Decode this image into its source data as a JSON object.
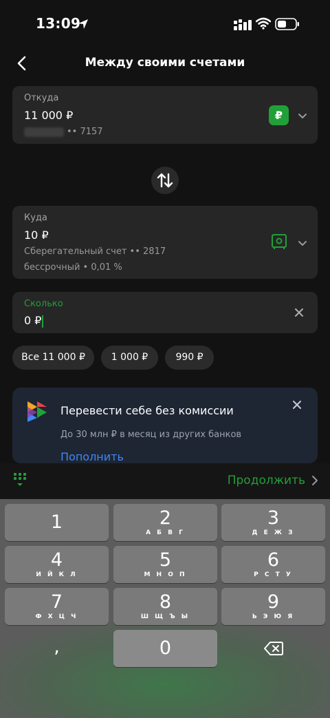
{
  "status": {
    "time": "13:09"
  },
  "header": {
    "title": "Между своими счетами"
  },
  "from_card": {
    "label": "Откуда",
    "amount": "11 000 ₽",
    "account_mask": "•• 7157",
    "currency_badge": "₽"
  },
  "to_card": {
    "label": "Куда",
    "amount": "10 ₽",
    "account_name": "Сберегательный счет •• 2817",
    "terms": "бессрочный • 0,01 %"
  },
  "amount_field": {
    "label": "Сколько",
    "value": "0 ₽"
  },
  "quick_amounts": [
    "Все 11 000 ₽",
    "1 000 ₽",
    "990 ₽"
  ],
  "promo": {
    "title": "Перевести себе без комиссии",
    "text": "До 30 млн ₽ в месяц из других банков",
    "link": "Пополнить"
  },
  "action": {
    "continue_label": "Продолжить"
  },
  "keyboard": {
    "keys": [
      {
        "digit": "1",
        "letters": ""
      },
      {
        "digit": "2",
        "letters": "А Б В Г"
      },
      {
        "digit": "3",
        "letters": "Д Е Ж З"
      },
      {
        "digit": "4",
        "letters": "И Й К Л"
      },
      {
        "digit": "5",
        "letters": "М Н О П"
      },
      {
        "digit": "6",
        "letters": "Р С Т У"
      },
      {
        "digit": "7",
        "letters": "Ф Х Ц Ч"
      },
      {
        "digit": "8",
        "letters": "Ш Щ Ъ Ы"
      },
      {
        "digit": "9",
        "letters": "Ь Э Ю Я"
      },
      {
        "digit": ",",
        "letters": ""
      },
      {
        "digit": "0",
        "letters": ""
      }
    ]
  },
  "colors": {
    "accent_green": "#21a038",
    "link_blue": "#3f88f5",
    "card_bg": "#262626",
    "promo_bg": "#1e2533"
  },
  "icons": [
    "location-arrow-icon",
    "signal-icon",
    "wifi-icon",
    "battery-icon",
    "back-arrow-icon",
    "chevron-down-icon",
    "ruble-badge-icon",
    "safe-icon",
    "swap-arrows-icon",
    "clear-icon",
    "sber-logo-icon",
    "close-icon",
    "keypad-icon",
    "chevron-right-icon",
    "backspace-icon"
  ]
}
